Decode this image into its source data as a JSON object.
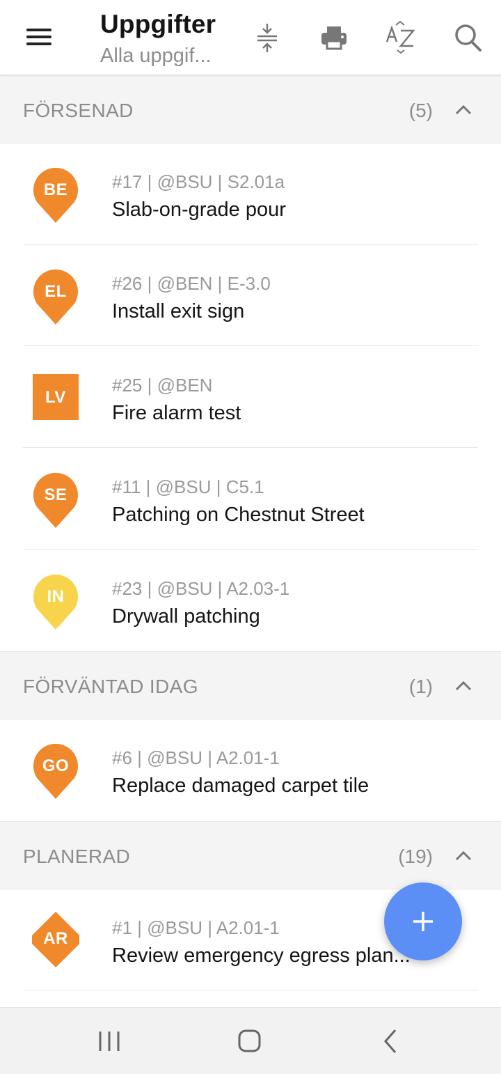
{
  "appbar": {
    "title": "Uppgifter",
    "subtitle": "Alla uppgif...",
    "icons": [
      "menu-icon",
      "collapse-icon",
      "print-icon",
      "sort-az-icon",
      "search-icon"
    ]
  },
  "colors": {
    "orange": "#f0892b",
    "yellow": "#f7d44c",
    "fab": "#5b8ff5",
    "section_bg": "#f4f4f5"
  },
  "sections": [
    {
      "title": "FÖRSENAD",
      "count": "(5)",
      "tasks": [
        {
          "initials": "BE",
          "meta": "#17 | @BSU | S2.01a",
          "name": "Slab-on-grade pour",
          "shape": "pin",
          "color": "#f0892b"
        },
        {
          "initials": "EL",
          "meta": "#26 | @BEN | E-3.0",
          "name": "Install exit sign",
          "shape": "pin",
          "color": "#f0892b"
        },
        {
          "initials": "LV",
          "meta": "#25 | @BEN",
          "name": "Fire alarm test",
          "shape": "square",
          "color": "#f0892b"
        },
        {
          "initials": "SE",
          "meta": "#11 | @BSU | C5.1",
          "name": "Patching on Chestnut Street",
          "shape": "pin",
          "color": "#f0892b"
        },
        {
          "initials": "IN",
          "meta": "#23 | @BSU | A2.03-1",
          "name": "Drywall patching",
          "shape": "pin",
          "color": "#f7d44c"
        }
      ]
    },
    {
      "title": "FÖRVÄNTAD IDAG",
      "count": "(1)",
      "tasks": [
        {
          "initials": "GO",
          "meta": "#6 | @BSU | A2.01-1",
          "name": "Replace damaged carpet tile",
          "shape": "pin",
          "color": "#f0892b"
        }
      ]
    },
    {
      "title": "PLANERAD",
      "count": "(19)",
      "tasks": [
        {
          "initials": "AR",
          "meta": "#1 | @BSU | A2.01-1",
          "name": "Review emergency egress plan...",
          "shape": "diamond",
          "color": "#f0892b"
        }
      ]
    }
  ],
  "fab": {
    "icon": "plus-icon"
  },
  "navbar": {
    "icons": [
      "recent-apps-icon",
      "home-icon",
      "back-icon"
    ]
  }
}
